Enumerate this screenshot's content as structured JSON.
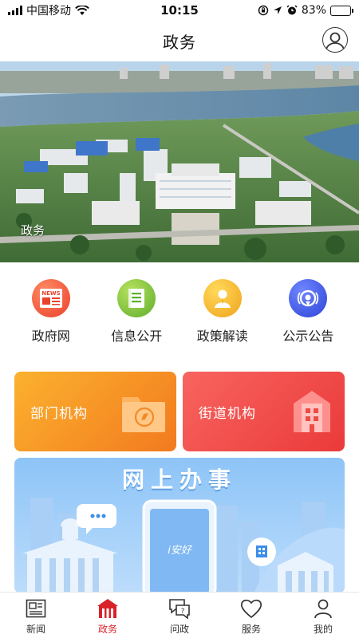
{
  "status_bar": {
    "carrier": "中国移动",
    "time": "10:15",
    "battery_percent": "83%",
    "battery_level": 0.83,
    "icons": [
      "signal-icon",
      "wifi-icon",
      "rotation-lock-icon",
      "location-icon",
      "alarm-icon",
      "battery-icon"
    ]
  },
  "header": {
    "title": "政务",
    "avatar_icon": "user-avatar-icon"
  },
  "banner": {
    "caption": "政务"
  },
  "quick_entries": [
    {
      "label": "政府网",
      "icon": "news-icon",
      "badge": "NEWS",
      "color": "#f05a3c"
    },
    {
      "label": "信息公开",
      "icon": "document-icon",
      "color": "#7cc63c"
    },
    {
      "label": "政策解读",
      "icon": "speaker-person-icon",
      "color": "#f5b82a"
    },
    {
      "label": "公示公告",
      "icon": "broadcast-icon",
      "color": "#4a63e6"
    }
  ],
  "cards": [
    {
      "label": "部门机构",
      "icon": "compass-folder-icon"
    },
    {
      "label": "街道机构",
      "icon": "building-icon"
    }
  ],
  "online_service": {
    "title": "网上办事",
    "phone_text": "i安好"
  },
  "tabbar": {
    "active": "政务",
    "items": [
      {
        "label": "新闻",
        "icon": "newspaper-icon"
      },
      {
        "label": "政务",
        "icon": "gov-building-icon"
      },
      {
        "label": "问政",
        "icon": "question-chat-icon"
      },
      {
        "label": "服务",
        "icon": "heart-icon"
      },
      {
        "label": "我的",
        "icon": "person-icon"
      }
    ]
  }
}
